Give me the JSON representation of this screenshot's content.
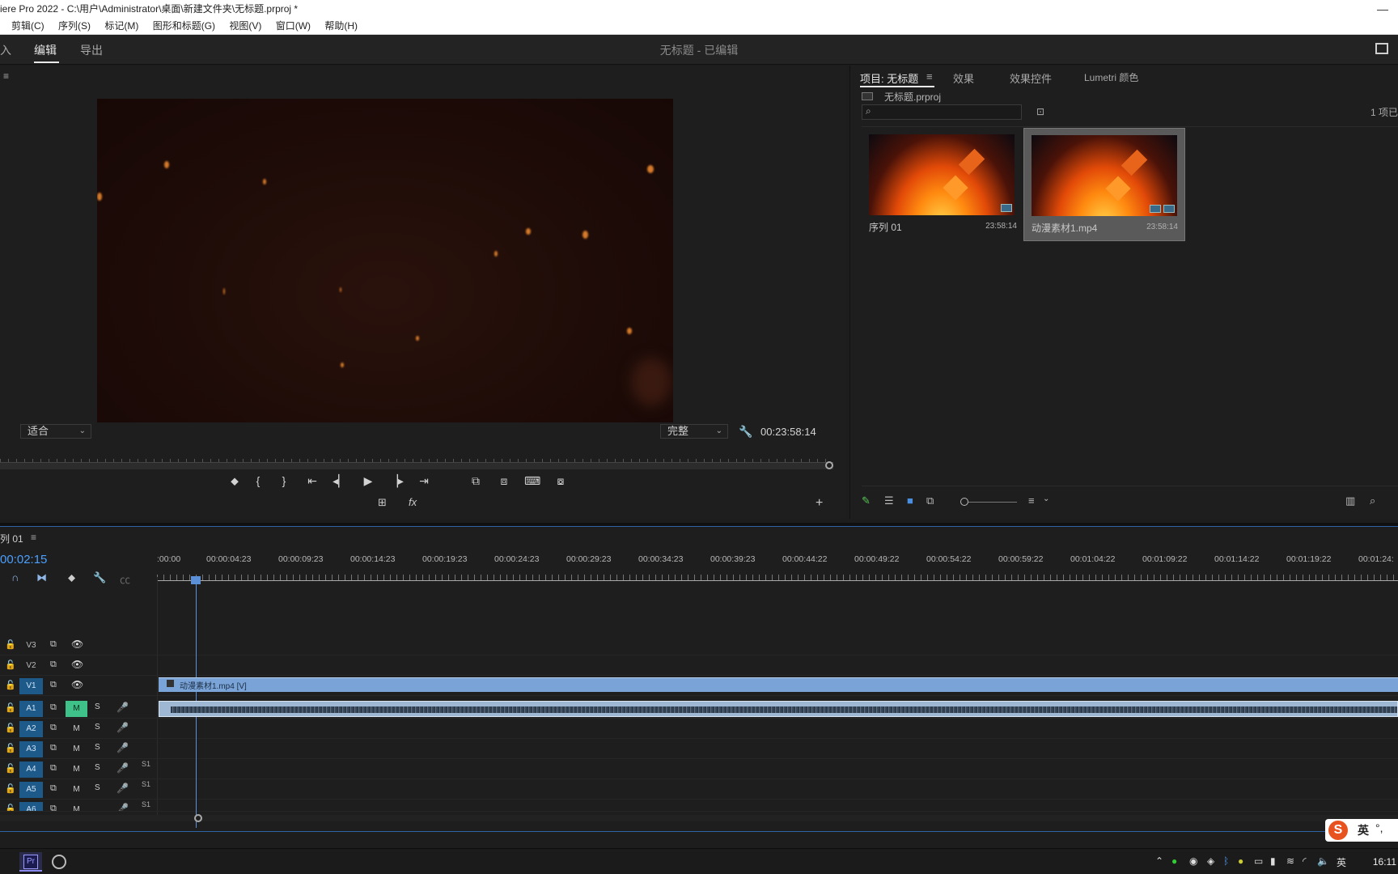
{
  "window": {
    "title": "iere Pro 2022 - C:\\用户\\Administrator\\桌面\\新建文件夹\\无标题.prproj *",
    "minimize": "—"
  },
  "menu": [
    "剪辑(C)",
    "序列(S)",
    "标记(M)",
    "图形和标题(G)",
    "视图(V)",
    "窗口(W)",
    "帮助(H)"
  ],
  "workspace": {
    "tabs": [
      "入",
      "编辑",
      "导出"
    ],
    "active_tab": "编辑",
    "doc_title": "无标题 - 已编辑"
  },
  "monitor": {
    "panel_menu": "≡",
    "fit_label": "适合",
    "quality_label": "完整",
    "timecode": "00:23:58:14",
    "transport": [
      "⬥",
      "{",
      "}",
      "⇤",
      "◂▏",
      "▶",
      "▕▸",
      "⇥",
      "⧉",
      "⧈",
      "⌨",
      "⧇"
    ],
    "add_button": "+",
    "extra_tools": [
      "⊞",
      "fx"
    ]
  },
  "project": {
    "tabs": [
      "项目: 无标题",
      "效果",
      "效果控件",
      "Lumetri 颜色"
    ],
    "tab_menu": "≡",
    "file_name": "无标题.prproj",
    "search_placeholder": "",
    "item_count": "1 项已",
    "items": [
      {
        "name": "序列 01",
        "duration": "23:58:14",
        "selected": false
      },
      {
        "name": "动漫素材1.mp4",
        "duration": "23:58:14",
        "selected": true
      }
    ]
  },
  "timeline": {
    "sequence_tab": "列 01",
    "sequence_menu": "≡",
    "timecode": "00:02:15",
    "ruler_labels": [
      ":00:00",
      "00:00:04:23",
      "00:00:09:23",
      "00:00:14:23",
      "00:00:19:23",
      "00:00:24:23",
      "00:00:29:23",
      "00:00:34:23",
      "00:00:39:23",
      "00:00:44:22",
      "00:00:49:22",
      "00:00:54:22",
      "00:00:59:22",
      "00:01:04:22",
      "00:01:09:22",
      "00:01:14:22",
      "00:01:19:22",
      "00:01:24:"
    ],
    "video_tracks": [
      {
        "name": "V3",
        "targeted": false
      },
      {
        "name": "V2",
        "targeted": false
      },
      {
        "name": "V1",
        "targeted": true
      }
    ],
    "audio_tracks": [
      {
        "name": "A1",
        "mute_on": true,
        "s1": ""
      },
      {
        "name": "A2",
        "mute_on": false,
        "s1": ""
      },
      {
        "name": "A3",
        "mute_on": false,
        "s1": ""
      },
      {
        "name": "A4",
        "mute_on": false,
        "s1": "S1"
      },
      {
        "name": "A5",
        "mute_on": false,
        "s1": "S1"
      },
      {
        "name": "A6",
        "mute_on": false,
        "s1": "S1"
      }
    ],
    "mute_label": "M",
    "solo_label": "S",
    "video_clip_label": "动漫素材1.mp4 [V]"
  },
  "ime": {
    "lang": "英",
    "punct": "°,"
  },
  "taskbar": {
    "pr_label": "Pr",
    "lang": "英",
    "clock": "16:11"
  },
  "colors": {
    "accent": "#4aa0ff",
    "track_target": "#1d5a8a",
    "mute_on": "#3ec28a",
    "video_clip": "#7aa4d8"
  }
}
